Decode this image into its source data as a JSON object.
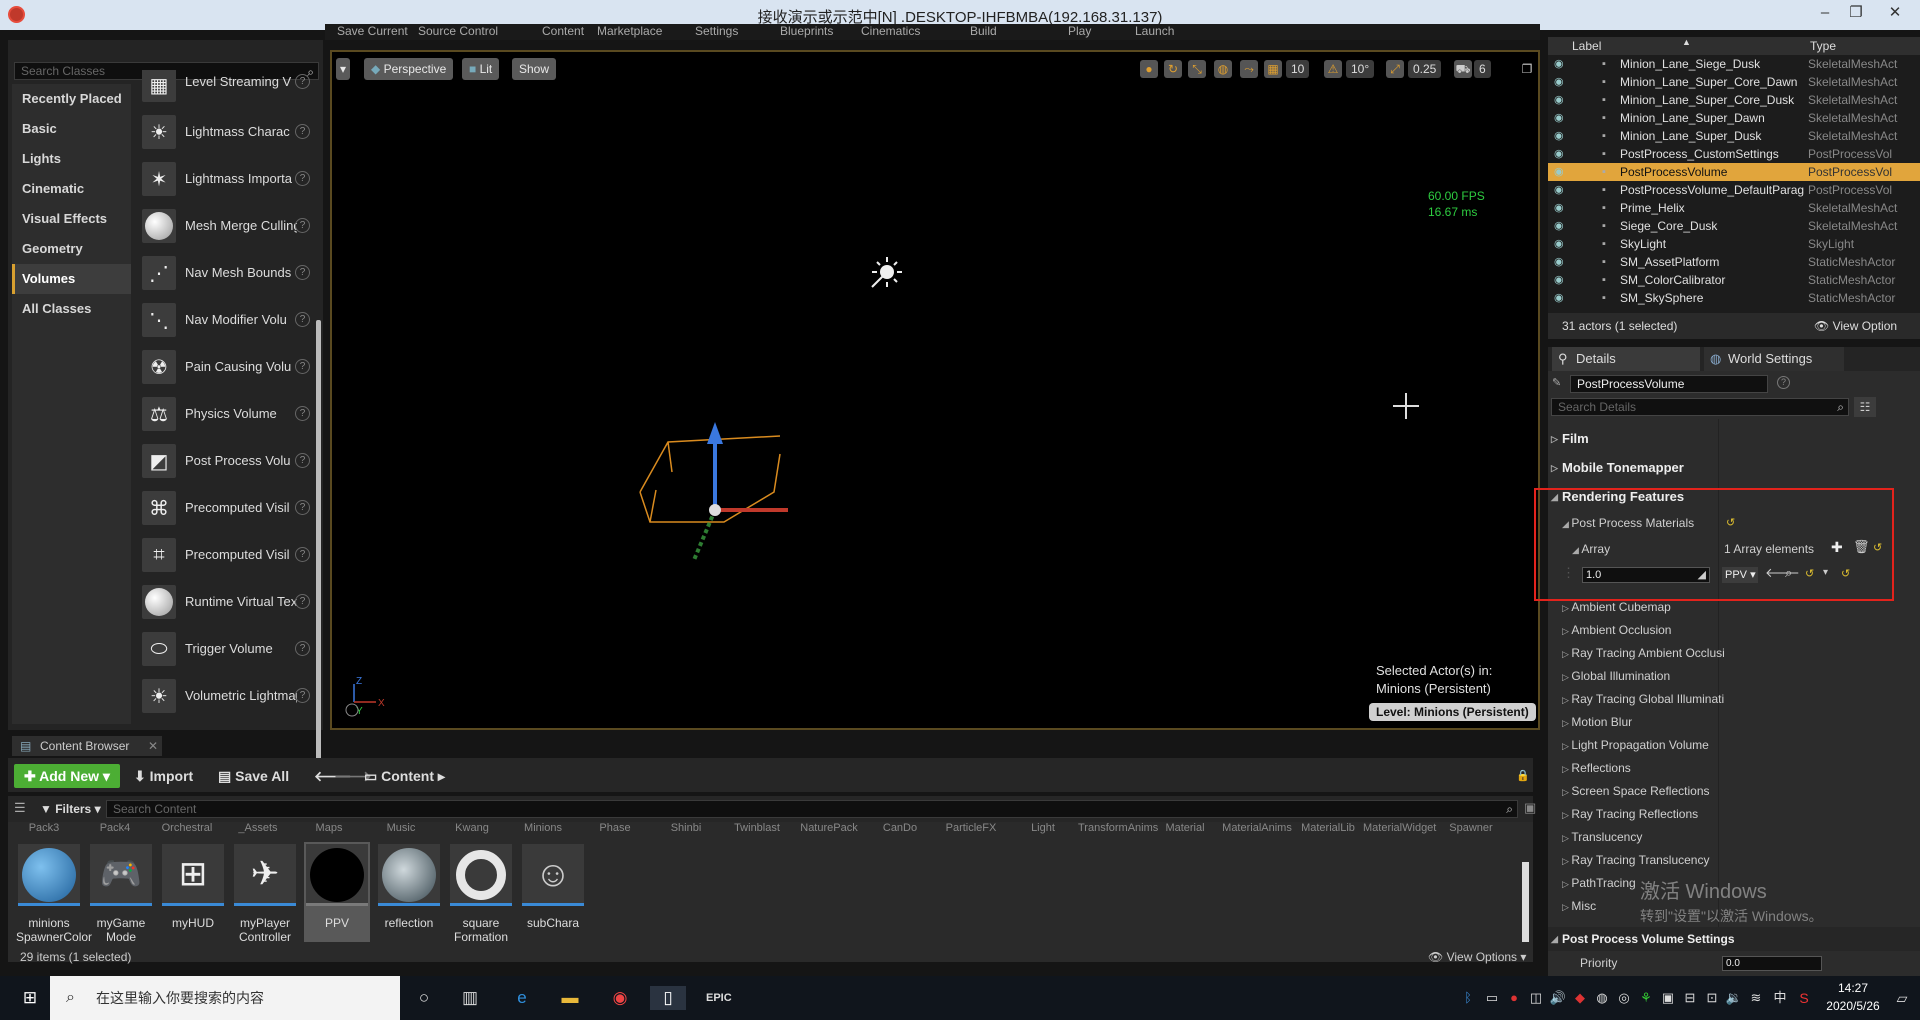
{
  "window": {
    "title": "接收演示或示范中[N] .DESKTOP-IHFBMBA(192.168.31.137)"
  },
  "top_toolbar": {
    "items": [
      "Save Current",
      "Source Control",
      "Content",
      "Marketplace",
      "Settings",
      "Blueprints",
      "Cinematics",
      "Build",
      "Play",
      "Launch"
    ]
  },
  "place_panel": {
    "search_placeholder": "Search Classes",
    "categories": [
      "Recently Placed",
      "Basic",
      "Lights",
      "Cinematic",
      "Visual Effects",
      "Geometry",
      "Volumes",
      "All Classes"
    ],
    "selected_category": "Volumes",
    "items": [
      {
        "label": "Level Streaming V",
        "icon": "level-streaming-icon"
      },
      {
        "label": "Lightmass Charac",
        "icon": "lightmass-icon"
      },
      {
        "label": "Lightmass Importa",
        "icon": "lightmass-importance-icon"
      },
      {
        "label": "Mesh Merge Culling V",
        "icon": "sphere-icon"
      },
      {
        "label": "Nav Mesh Bounds",
        "icon": "nav-mesh-icon"
      },
      {
        "label": "Nav Modifier Volu",
        "icon": "nav-modifier-icon"
      },
      {
        "label": "Pain Causing Volu",
        "icon": "pain-causing-icon"
      },
      {
        "label": "Physics Volume",
        "icon": "physics-volume-icon"
      },
      {
        "label": "Post Process Volu",
        "icon": "post-process-icon"
      },
      {
        "label": "Precomputed Visil",
        "icon": "precomputed-visibility-icon"
      },
      {
        "label": "Precomputed Visil",
        "icon": "precomputed-visibility-override-icon"
      },
      {
        "label": "Runtime Virtual Textu",
        "icon": "sphere-icon"
      },
      {
        "label": "Trigger Volume",
        "icon": "trigger-volume-icon"
      },
      {
        "label": "Volumetric Lightmap I",
        "icon": "volumetric-lightmap-icon"
      }
    ]
  },
  "viewport": {
    "perspective": "Perspective",
    "lit": "Lit",
    "show": "Show",
    "grid_snap": "10",
    "rot_snap": "10°",
    "scale_snap": "0.25",
    "cam_speed": "6",
    "fps": "60.00 FPS",
    "ms": "16.67 ms",
    "selected_line1": "Selected Actor(s) in:",
    "selected_line2": "Minions (Persistent)",
    "level_label": "Level:  Minions (Persistent)",
    "axis_z": "Z",
    "axis_y": "Y",
    "axis_x": "X"
  },
  "content_browser": {
    "tab": "Content Browser",
    "add_new": "Add New",
    "import": "Import",
    "save_all": "Save All",
    "path": "Content",
    "filters": "Filters",
    "search_placeholder": "Search Content",
    "top_row": [
      "Pack3",
      "Pack4",
      "Orchestral",
      "_Assets",
      "Maps",
      "Music",
      "Kwang",
      "Minions",
      "Phase",
      "Shinbi",
      "Twinblast",
      "NaturePack",
      "CanDo",
      "ParticleFX",
      "Light",
      "TransformAnims",
      "Material",
      "MaterialAnims",
      "MaterialLib",
      "MaterialWidget",
      "Spawner"
    ],
    "assets": [
      {
        "name": "minions SpawnerColor",
        "selected": false
      },
      {
        "name": "myGame Mode",
        "selected": false
      },
      {
        "name": "myHUD",
        "selected": false
      },
      {
        "name": "myPlayer Controller",
        "selected": false
      },
      {
        "name": "PPV",
        "selected": true
      },
      {
        "name": "reflection",
        "selected": false
      },
      {
        "name": "square Formation",
        "selected": false
      },
      {
        "name": "subChara",
        "selected": false
      }
    ],
    "count": "29 items (1 selected)",
    "view_options": "View Options"
  },
  "outliner": {
    "col_label": "Label",
    "col_type": "Type",
    "rows": [
      {
        "label": "Minion_Lane_Siege_Dusk",
        "type": "SkeletalMeshAct",
        "selected": false
      },
      {
        "label": "Minion_Lane_Super_Core_Dawn",
        "type": "SkeletalMeshAct",
        "selected": false
      },
      {
        "label": "Minion_Lane_Super_Core_Dusk",
        "type": "SkeletalMeshAct",
        "selected": false
      },
      {
        "label": "Minion_Lane_Super_Dawn",
        "type": "SkeletalMeshAct",
        "selected": false
      },
      {
        "label": "Minion_Lane_Super_Dusk",
        "type": "SkeletalMeshAct",
        "selected": false
      },
      {
        "label": "PostProcess_CustomSettings",
        "type": "PostProcessVol",
        "selected": false
      },
      {
        "label": "PostProcessVolume",
        "type": "PostProcessVol",
        "selected": true
      },
      {
        "label": "PostProcessVolume_DefaultParag",
        "type": "PostProcessVol",
        "selected": false
      },
      {
        "label": "Prime_Helix",
        "type": "SkeletalMeshAct",
        "selected": false
      },
      {
        "label": "Siege_Core_Dusk",
        "type": "SkeletalMeshAct",
        "selected": false
      },
      {
        "label": "SkyLight",
        "type": "SkyLight",
        "selected": false
      },
      {
        "label": "SM_AssetPlatform",
        "type": "StaticMeshActor",
        "selected": false
      },
      {
        "label": "SM_ColorCalibrator",
        "type": "StaticMeshActor",
        "selected": false
      },
      {
        "label": "SM_SkySphere",
        "type": "StaticMeshActor",
        "selected": false
      }
    ],
    "footer": "31 actors (1 selected)",
    "view_options": "View Option"
  },
  "details": {
    "tab_details": "Details",
    "tab_world": "World Settings",
    "object_name": "PostProcessVolume",
    "search_placeholder": "Search Details",
    "sections": [
      "Film",
      "Mobile Tonemapper",
      "Rendering Features"
    ],
    "ppm_label": "Post Process Materials",
    "array_label": "Array",
    "array_count": "1 Array elements",
    "weight_value": "1.0",
    "material_value": "PPV",
    "subsections": [
      "Ambient Cubemap",
      "Ambient Occlusion",
      "Ray Tracing Ambient Occlusi",
      "Global Illumination",
      "Ray Tracing Global Illuminati",
      "Motion Blur",
      "Light Propagation Volume",
      "Reflections",
      "Screen Space Reflections",
      "Ray Tracing Reflections",
      "Translucency",
      "Ray Tracing Translucency",
      "PathTracing",
      "Misc"
    ],
    "ppv_settings": "Post Process Volume Settings",
    "priority_label": "Priority",
    "priority_value": "0.0"
  },
  "taskbar": {
    "search_placeholder": "在这里输入你要搜索的内容",
    "time": "14:27",
    "date": "2020/5/26",
    "ime": "中"
  },
  "watermark": {
    "line1": "激活 Windows",
    "line2": "转到\"设置\"以激活 Windows。"
  }
}
